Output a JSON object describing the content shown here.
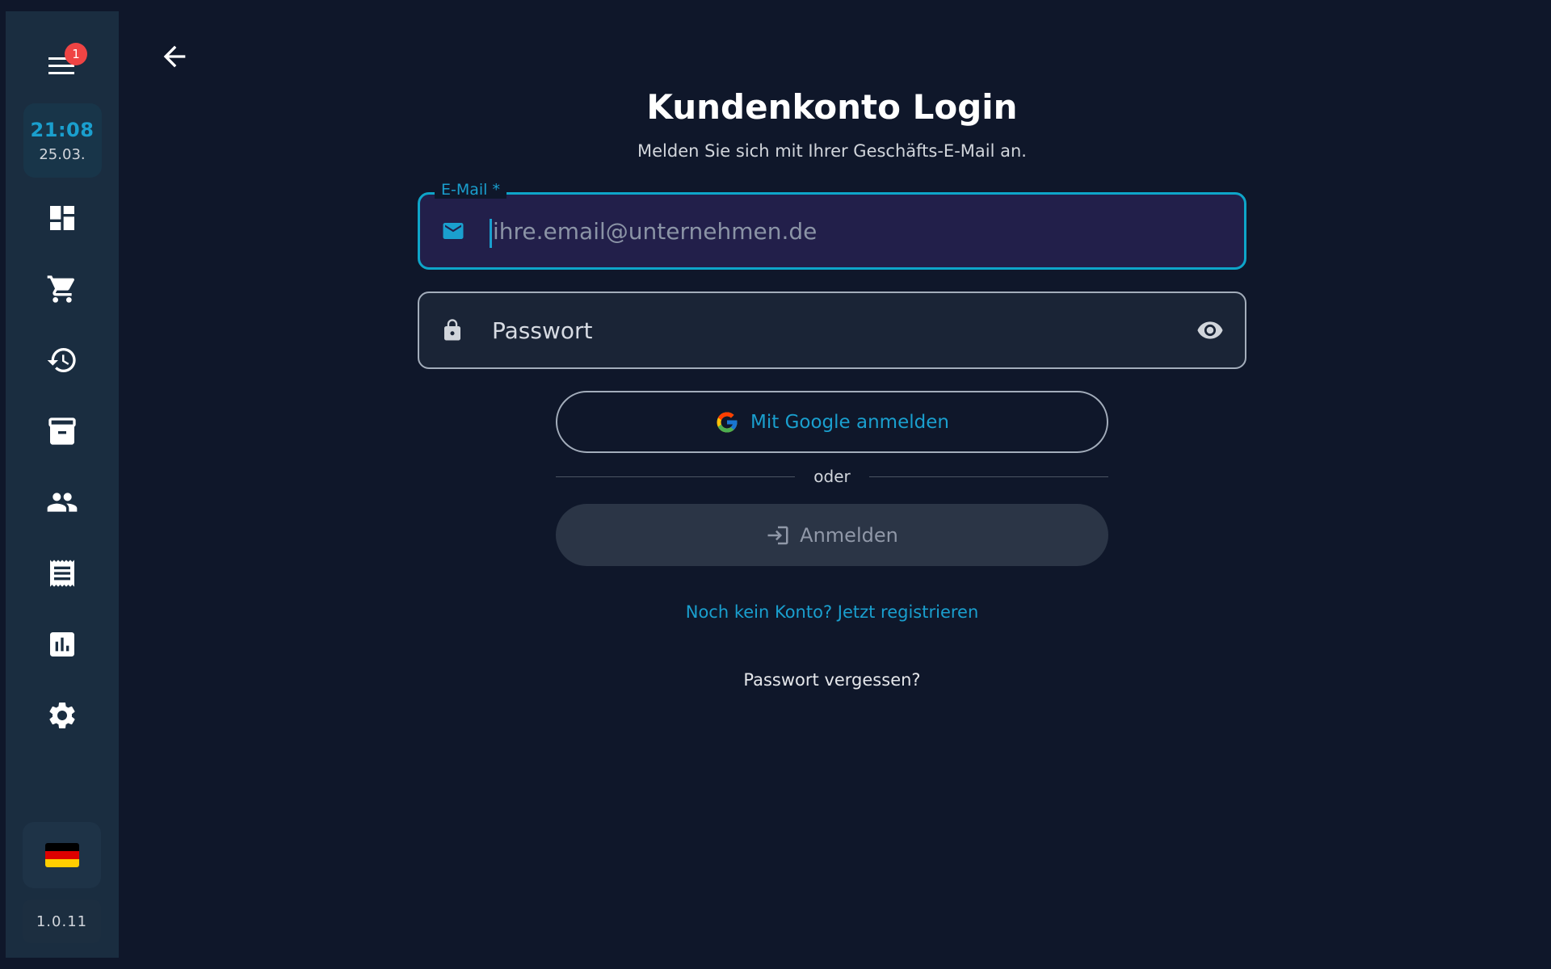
{
  "sidebar": {
    "menu_badge": "1",
    "clock_time": "21:08",
    "clock_date": "25.03.",
    "nav_icons": [
      "dashboard-icon",
      "cart-icon",
      "history-icon",
      "archive-icon",
      "customers-icon",
      "receipt-icon",
      "statistics-icon",
      "settings-icon"
    ],
    "language_icon": "german-flag-icon",
    "version": "1.0.11"
  },
  "header": {
    "back_icon": "arrow-left-icon"
  },
  "main": {
    "title": "Kundenkonto Login",
    "subtitle": "Melden Sie sich mit Ihrer Geschäfts-E-Mail an.",
    "email": {
      "label": "E-Mail *",
      "placeholder": "ihre.email@unternehmen.de",
      "value": ""
    },
    "password": {
      "placeholder": "Passwort",
      "value": ""
    },
    "google_button": "Mit Google anmelden",
    "divider": "oder",
    "login_button": "Anmelden",
    "register_link": "Noch kein Konto? Jetzt registrieren",
    "forgot_link": "Passwort vergessen?"
  },
  "colors": {
    "background": "#0f172a",
    "sidebar": "#1a2d40",
    "accent": "#1a9fce",
    "badge": "#ef4444",
    "email_field_bg": "#221f4a",
    "disabled_button": "#2b3546"
  }
}
